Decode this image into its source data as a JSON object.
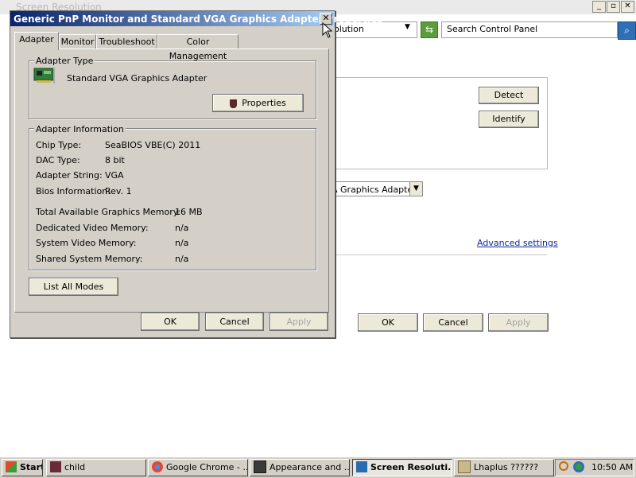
{
  "background_window": {
    "title": "Screen Resolution",
    "address_text": "olution",
    "search_placeholder": "Search Control Panel",
    "detect_label": "Detect",
    "identify_label": "Identify",
    "display_value": "A Graphics Adapter",
    "advanced_settings_label": "Advanced settings",
    "ok_label": "OK",
    "cancel_label": "Cancel",
    "apply_label": "Apply"
  },
  "dialog": {
    "title": "Generic PnP Monitor and Standard VGA Graphics Adapter Properties",
    "tabs": [
      {
        "label": "Adapter",
        "active": true
      },
      {
        "label": "Monitor",
        "active": false
      },
      {
        "label": "Troubleshoot",
        "active": false
      },
      {
        "label": "Color Management",
        "active": false
      }
    ],
    "adapter_type": {
      "group_label": "Adapter Type",
      "name": "Standard VGA Graphics Adapter",
      "properties_label": "Properties"
    },
    "adapter_info": {
      "group_label": "Adapter Information",
      "rows": [
        {
          "label": "Chip Type:",
          "value": "SeaBIOS VBE(C) 2011"
        },
        {
          "label": "DAC Type:",
          "value": "8 bit"
        },
        {
          "label": "Adapter String:",
          "value": "VGA"
        },
        {
          "label": "Bios Information:",
          "value": "Rev. 1"
        }
      ],
      "memory_rows": [
        {
          "label": "Total Available Graphics Memory:",
          "value": "16 MB"
        },
        {
          "label": "Dedicated Video Memory:",
          "value": "n/a"
        },
        {
          "label": "System Video Memory:",
          "value": "n/a"
        },
        {
          "label": "Shared System Memory:",
          "value": "n/a"
        }
      ]
    },
    "list_all_modes_label": "List All Modes",
    "ok_label": "OK",
    "cancel_label": "Cancel",
    "apply_label": "Apply"
  },
  "taskbar": {
    "start_label": "Start",
    "items": [
      {
        "label": "child"
      },
      {
        "label": "Google Chrome - ..."
      },
      {
        "label": "Appearance and ..."
      },
      {
        "label": "Screen Resoluti..."
      },
      {
        "label": "Lhaplus ??????"
      }
    ],
    "clock": "10:50 AM"
  },
  "colors": {
    "title_gradient_start": "#0a246a",
    "title_gradient_end": "#a6caf0",
    "face": "#d4d0c8",
    "link": "#0a2c9a"
  }
}
